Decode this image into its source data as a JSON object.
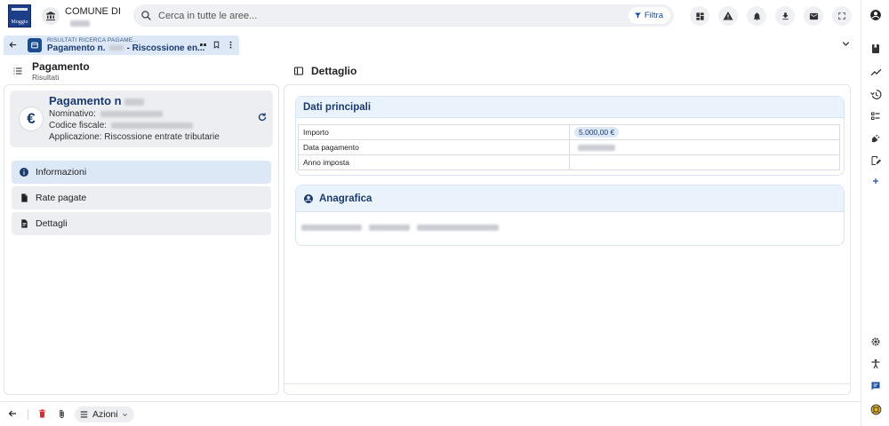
{
  "header": {
    "logo_text": "Moggio",
    "comune_label": "COMUNE DI",
    "search_placeholder": "Cerca in tutte le aree...",
    "filter_label": "Filtra",
    "icons": [
      "dashboard-icon",
      "warning-icon",
      "notifications-icon",
      "download-icon",
      "mail-icon",
      "fullscreen-icon"
    ]
  },
  "rail": {
    "top_icon": "account-icon",
    "items": [
      "book-icon",
      "trending-icon",
      "history-icon",
      "checklist-icon",
      "plugin-icon",
      "edit-note-icon",
      "plus-icon"
    ],
    "bottom_items": [
      "settings-icon",
      "accessibility-icon",
      "chat-icon",
      "help-icon"
    ]
  },
  "tab": {
    "crumb_top": "RISULTATI RICERCA PAGAME...",
    "crumb_title_prefix": "Pagamento n.",
    "crumb_title_suffix": "- Riscossione en..."
  },
  "left": {
    "title": "Pagamento",
    "subtitle": "Risultati",
    "card": {
      "title": "Pagamento n",
      "nominativo_label": "Nominativo:",
      "codice_label": "Codice fiscale:",
      "applicazione": "Applicazione: Riscossione entrate tributarie"
    },
    "menu": [
      {
        "label": "Informazioni",
        "icon": "info-icon",
        "active": true
      },
      {
        "label": "Rate pagate",
        "icon": "document-icon",
        "active": false
      },
      {
        "label": "Dettagli",
        "icon": "document-detail-icon",
        "active": false
      }
    ]
  },
  "right": {
    "title": "Dettaglio",
    "dati_principali": {
      "title": "Dati principali",
      "rows": [
        {
          "label": "Importo",
          "value": "5.000,00 €"
        },
        {
          "label": "Data pagamento",
          "value": ""
        },
        {
          "label": "Anno imposta",
          "value": ""
        }
      ]
    },
    "anagrafica": {
      "title": "Anagrafica"
    }
  },
  "bottom": {
    "azioni_label": "Azioni"
  },
  "colors": {
    "brand": "#1b3a6d",
    "tab_bg": "#dde8f6",
    "section_header": "#eaf3fb",
    "delete": "#d32f2f"
  }
}
